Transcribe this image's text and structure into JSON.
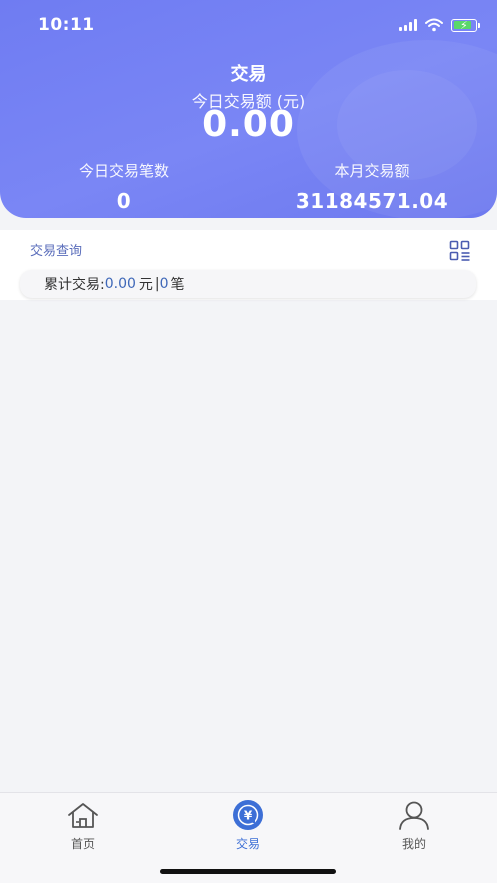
{
  "status_bar": {
    "time": "10:11"
  },
  "header": {
    "title": "交易",
    "today_amount_label": "今日交易额 (元)",
    "today_amount_value": "0.00",
    "today_count_label": "今日交易笔数",
    "today_count_value": "0",
    "month_amount_label": "本月交易额",
    "month_amount_value": "31184571.04"
  },
  "query": {
    "title": "交易查询",
    "summary_prefix": "累计交易:",
    "summary_amount": "0.00",
    "summary_unit": "元",
    "summary_sep": "|",
    "summary_count": "0",
    "summary_count_unit": "笔"
  },
  "tabbar": {
    "items": [
      {
        "label": "首页",
        "icon": "home-icon"
      },
      {
        "label": "交易",
        "icon": "yuan-exchange-icon",
        "active": true
      },
      {
        "label": "我的",
        "icon": "person-icon"
      }
    ]
  },
  "colors": {
    "header_gradient": "#6f7cf2",
    "accent_blue": "#3d6fd6",
    "query_title": "#5a6dbb",
    "number_blue": "#3e67b8",
    "battery_green": "#5ad86a"
  }
}
